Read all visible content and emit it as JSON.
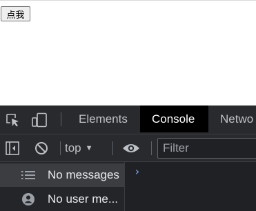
{
  "page": {
    "button_label": "点我"
  },
  "devtools": {
    "tabs": [
      {
        "label": "Elements",
        "active": false
      },
      {
        "label": "Console",
        "active": true
      },
      {
        "label": "Netwo",
        "active": false
      }
    ],
    "toolbar": {
      "context_label": "top",
      "filter_placeholder": "Filter"
    },
    "sidebar": {
      "items": [
        {
          "label": "No messages",
          "icon": "list-icon",
          "selected": true
        },
        {
          "label": "No user me...",
          "icon": "user-icon",
          "selected": false
        }
      ]
    },
    "console": {
      "prompt_symbol": "›"
    },
    "colors": {
      "panel_bg": "#292a2d",
      "console_bg": "#202124",
      "active_tab_bg": "#000000",
      "text": "#bdc1c6",
      "prompt": "#7cacf8"
    }
  }
}
